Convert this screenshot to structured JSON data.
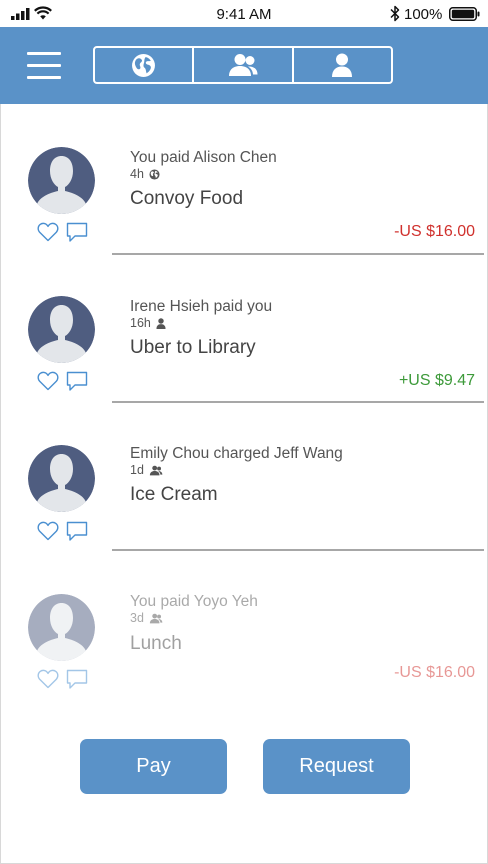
{
  "status_bar": {
    "time": "9:41 AM",
    "battery_percent": "100%",
    "icons": [
      "cellular-signal-icon",
      "wifi-icon",
      "bluetooth-icon",
      "battery-icon"
    ]
  },
  "header": {
    "background_color": "#5a92c8",
    "menu_icon": "hamburger-menu-icon",
    "tabs": [
      {
        "icon": "globe-icon",
        "name": "public"
      },
      {
        "icon": "friends-icon",
        "name": "friends"
      },
      {
        "icon": "person-icon",
        "name": "mine"
      }
    ]
  },
  "feed": [
    {
      "who": "You paid Alison Chen",
      "age": "4h",
      "visibility_icon": "globe-icon",
      "description": "Convoy Food",
      "amount": "-US $16.00",
      "amount_color": "#d0312d"
    },
    {
      "who": "Irene Hsieh paid you",
      "age": "16h",
      "visibility_icon": "person-icon",
      "description": "Uber to Library",
      "amount": "+US $9.47",
      "amount_color": "#3d9a3a"
    },
    {
      "who": "Emily Chou charged Jeff Wang",
      "age": "1d",
      "visibility_icon": "friends-icon",
      "description": "Ice Cream",
      "amount": "",
      "amount_color": "#333333"
    },
    {
      "who": "You paid Yoyo Yeh",
      "age": "3d",
      "visibility_icon": "friends-icon",
      "description": "Lunch",
      "amount": "-US $16.00",
      "amount_color": "#d0312d"
    }
  ],
  "buttons": {
    "pay_label": "Pay",
    "request_label": "Request"
  },
  "colors": {
    "avatar_bg": "#4f5d80",
    "avatar_figure": "#e3e6ea",
    "icon_outline": "#4a8fd0"
  }
}
